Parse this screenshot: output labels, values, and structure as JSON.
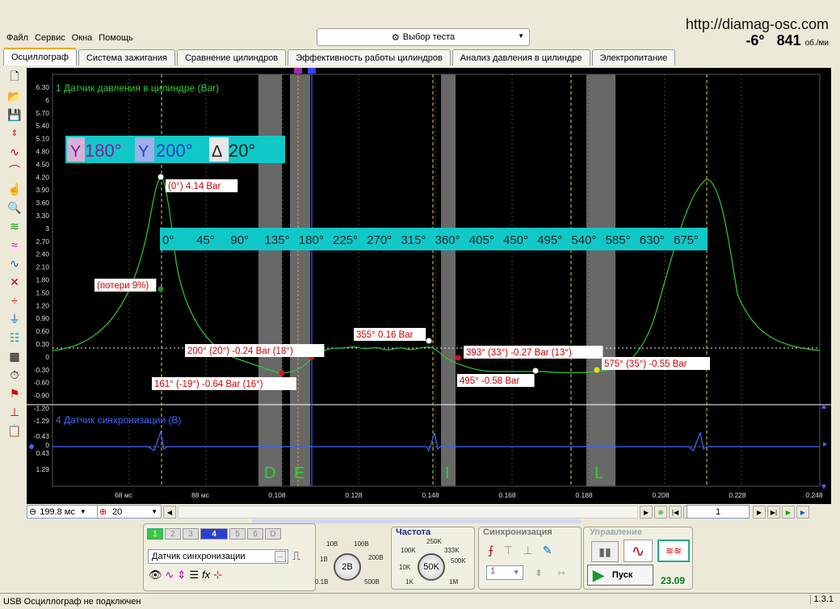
{
  "menu": [
    "Файл",
    "Сервис",
    "Окна",
    "Помощь"
  ],
  "test_select": "Выбор теста",
  "url": "http://diamag-osc.com",
  "rpm": {
    "angle": "-6°",
    "value": "841",
    "unit": "об./ми"
  },
  "tabs": [
    "Осциллограф",
    "Система зажигания",
    "Сравнение цилиндров",
    "Эффективность работы цилиндров",
    "Анализ давления в цилиндре",
    "Электропитание"
  ],
  "scope": {
    "ch1_label": "1 Датчик давления в цилиндре (Bar)",
    "ch4_label": "4 Датчик синхронизации (В)",
    "y_ticks_top": [
      "6.30",
      "6",
      "5.70",
      "5.40",
      "5.10",
      "4.80",
      "4.50",
      "4.20",
      "3.90",
      "3.60",
      "3.30",
      "3",
      "2.70",
      "2.40",
      "2.10",
      "1.80",
      "1.50",
      "1.20",
      "0.90",
      "0.60",
      "0.30",
      "0",
      "-0.30",
      "-0.60",
      "-0.90",
      "-1.20"
    ],
    "y_ticks_bottom": [
      "-1.29",
      "-0.43",
      "0",
      "0.43",
      "1.29"
    ],
    "x_ticks": [
      "68 мс",
      "88 мс",
      "0.108",
      "0.128",
      "0.148",
      "0.168",
      "0.188",
      "0.208",
      "0.228",
      "0.248"
    ],
    "angle_box": {
      "a1": "180°",
      "a2": "200°",
      "delta": "20°"
    },
    "degree_scale": [
      "0°",
      "45°",
      "90°",
      "135°",
      "180°",
      "225°",
      "270°",
      "315°",
      "360°",
      "405°",
      "450°",
      "495°",
      "540°",
      "585°",
      "630°",
      "675°"
    ],
    "zones": [
      "D",
      "E",
      "I",
      "L"
    ],
    "annotations": [
      {
        "text": "(0°) 4.14 Bar"
      },
      {
        "text": "(потери 9%)"
      },
      {
        "text": "355° 0.16 Bar"
      },
      {
        "text": "200° (20°) -0.24 Bar (18°)"
      },
      {
        "text": "393° (33°) -0.27 Bar (13°)"
      },
      {
        "text": "161° (-19°) -0.64 Bar (16°)"
      },
      {
        "text": "495° -0.58 Bar"
      },
      {
        "text": "575° (35°) -0.55 Bar"
      }
    ],
    "colors": {
      "ch1": "#2ecc2e",
      "ch4": "#3a66ff",
      "annot": "#cc0000",
      "bar": "#11c8c8"
    }
  },
  "nav": {
    "timebase": "199.8 мс",
    "divs": "20",
    "page": "1"
  },
  "channels": {
    "buttons": [
      "1",
      "2",
      "3",
      "4",
      "5",
      "6",
      "D"
    ],
    "active": "4",
    "name": "Датчик синхронизации",
    "volt_labels": [
      "10В",
      "100В",
      "1В",
      "200В",
      "0.1В",
      "500В"
    ],
    "volt_value": "2В"
  },
  "freq": {
    "title": "Частота",
    "labels": [
      "250K",
      "100K",
      "333K",
      "10K",
      "500K",
      "1K",
      "1M"
    ],
    "value": "50K"
  },
  "sync": {
    "title": "Синхронизация",
    "value": "1"
  },
  "control": {
    "title": "Управление",
    "start": "Пуск",
    "fps": "23.09"
  },
  "status": {
    "text": "USB Осциллограф не подключен",
    "version": "1.3.1"
  }
}
